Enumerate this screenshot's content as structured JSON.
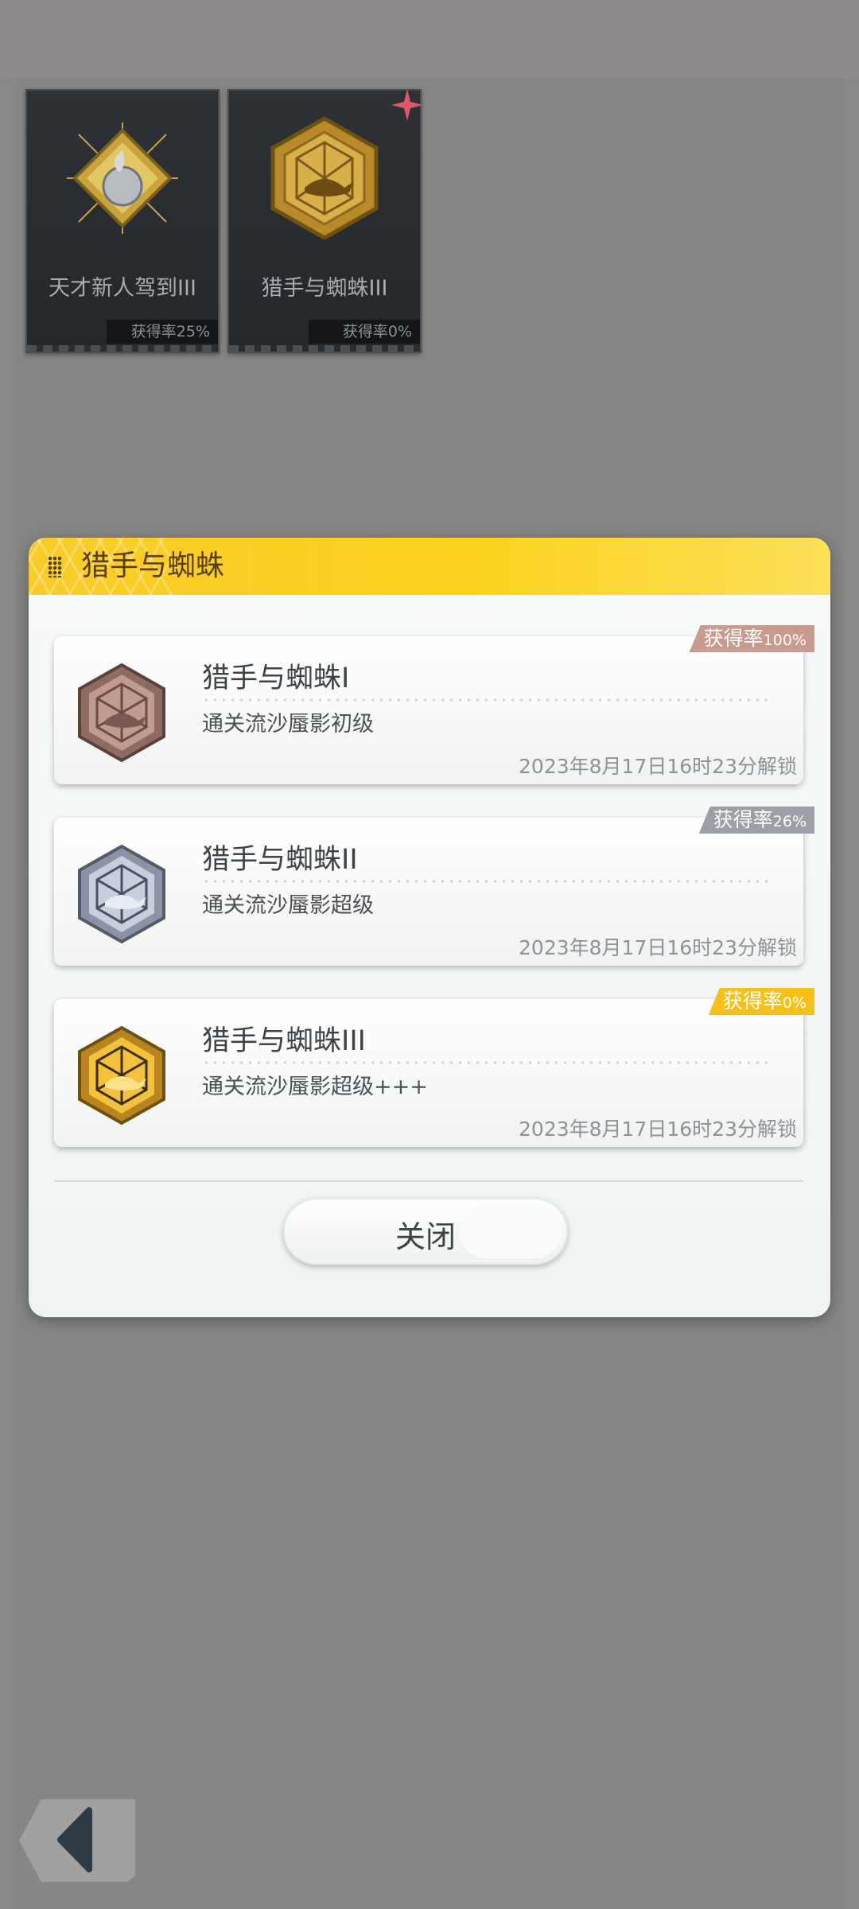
{
  "background_cards": [
    {
      "name": "天才新人驾到III",
      "rate": "获得率25%"
    },
    {
      "name": "猎手与蜘蛛III",
      "rate": "获得率0%"
    }
  ],
  "dialog": {
    "title": "猎手与蜘蛛",
    "achievements": [
      {
        "title": "猎手与蜘蛛I",
        "description": "通关流沙蜃影初级",
        "unlock_time": "2023年8月17日16时23分解锁",
        "rate_label": "获得率",
        "rate_value": "100%",
        "tier": "bronze",
        "badge_color": "#c89b8e"
      },
      {
        "title": "猎手与蜘蛛II",
        "description": "通关流沙蜃影超级",
        "unlock_time": "2023年8月17日16时23分解锁",
        "rate_label": "获得率",
        "rate_value": "26%",
        "tier": "silver",
        "badge_color": "#9aa0a6"
      },
      {
        "title": "猎手与蜘蛛III",
        "description": "通关流沙蜃影超级+++",
        "unlock_time": "2023年8月17日16时23分解锁",
        "rate_label": "获得率",
        "rate_value": "0%",
        "tier": "gold",
        "badge_color": "#f5c018"
      }
    ],
    "close_label": "关闭"
  },
  "icons": [
    "grip-icon",
    "medal-icon",
    "sparkle-icon",
    "back-arrow-icon"
  ]
}
